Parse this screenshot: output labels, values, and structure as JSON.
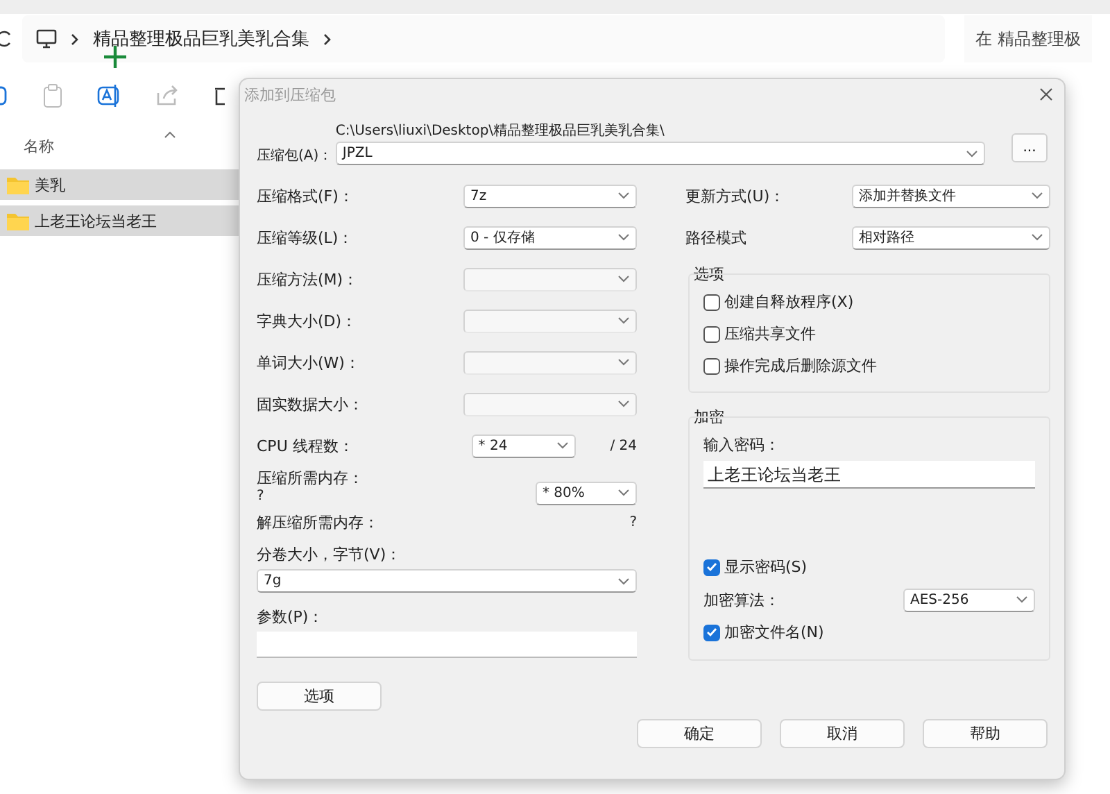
{
  "explorer": {
    "breadcrumb": [
      "精品整理极品巨乳美乳合集"
    ],
    "search": {
      "placeholder": "在 精品整理极"
    },
    "column": "名称",
    "files": [
      {
        "name": "美乳",
        "selected": true
      },
      {
        "name": "上老王论坛当老王",
        "selected": true
      }
    ]
  },
  "dialog": {
    "title": "添加到压缩包",
    "archive": {
      "label": "压缩包(A)：",
      "folder": "C:\\Users\\liuxi\\Desktop\\精品整理极品巨乳美乳合集\\",
      "value": "JPZL",
      "browse": "..."
    },
    "left_rows": [
      {
        "kind": "select",
        "label": "压缩格式(F)：",
        "value": "7z",
        "disabled": false
      },
      {
        "kind": "select",
        "label": "压缩等级(L)：",
        "value": "0 - 仅存储",
        "disabled": false
      },
      {
        "kind": "select",
        "label": "压缩方法(M)：",
        "disabled": true
      },
      {
        "kind": "select",
        "label": "字典大小(D)：",
        "disabled": true
      },
      {
        "kind": "select",
        "label": "单词大小(W)：",
        "disabled": true
      },
      {
        "kind": "select",
        "label": "固实数据大小：",
        "disabled": true
      },
      {
        "kind": "threads",
        "label": "CPU 线程数：",
        "value": "* 24",
        "suffix": "/ 24"
      },
      {
        "kind": "memory",
        "label": "压缩所需内存：",
        "note": "?",
        "value": "* 80%"
      },
      {
        "kind": "readout",
        "label": "解压缩所需内存：",
        "value": "?"
      }
    ],
    "volume": {
      "label": "分卷大小，字节(V)：",
      "value": "7g"
    },
    "params": {
      "label": "参数(P)："
    },
    "options_button": "选项",
    "update": {
      "label": "更新方式(U)：",
      "value": "添加并替换文件"
    },
    "path_mode": {
      "label": "路径模式",
      "value": "相对路径"
    },
    "options": {
      "title": "选项",
      "items": [
        {
          "label": "创建自释放程序(X)",
          "checked": false
        },
        {
          "label": "压缩共享文件",
          "checked": false
        },
        {
          "label": "操作完成后删除源文件",
          "checked": false
        }
      ]
    },
    "encryption": {
      "title": "加密",
      "password_label": "输入密码：",
      "password": "上老王论坛当老王",
      "show_password": {
        "label": "显示密码(S)",
        "checked": true
      },
      "method": {
        "label": "加密算法：",
        "value": "AES-256"
      },
      "encrypt_names": {
        "label": "加密文件名(N)",
        "checked": true
      }
    },
    "buttons": [
      "确定",
      "取消",
      "帮助"
    ]
  }
}
